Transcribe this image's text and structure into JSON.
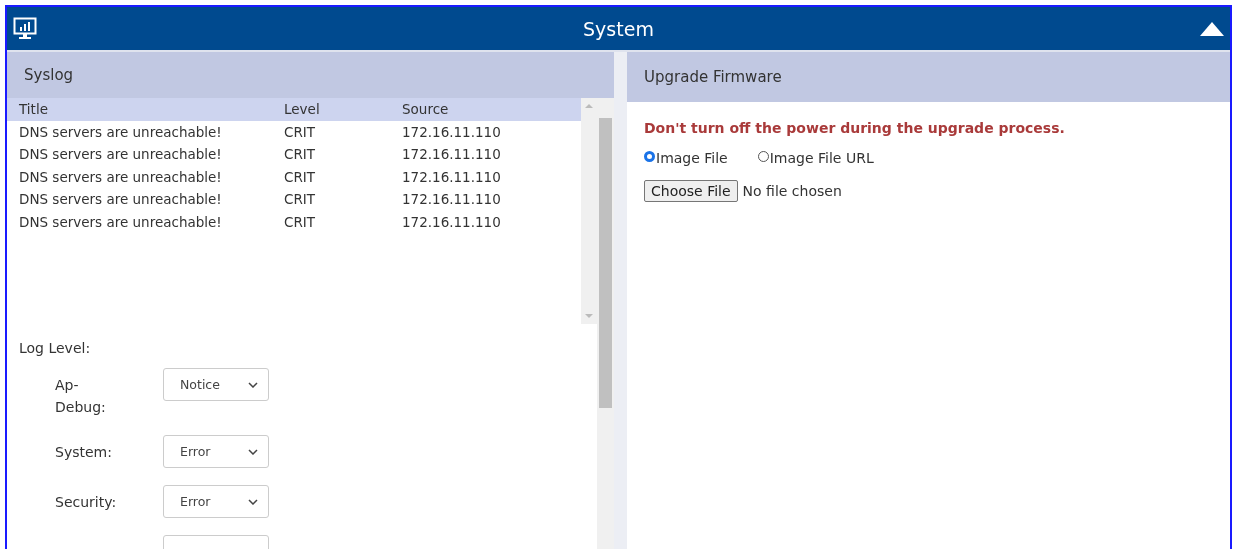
{
  "header": {
    "title": "System"
  },
  "syslog": {
    "title": "Syslog",
    "columns": [
      "Title",
      "Level",
      "Source"
    ],
    "rows": [
      [
        "DNS servers are unreachable!",
        "CRIT",
        "172.16.11.110"
      ],
      [
        "DNS servers are unreachable!",
        "CRIT",
        "172.16.11.110"
      ],
      [
        "DNS servers are unreachable!",
        "CRIT",
        "172.16.11.110"
      ],
      [
        "DNS servers are unreachable!",
        "CRIT",
        "172.16.11.110"
      ],
      [
        "DNS servers are unreachable!",
        "CRIT",
        "172.16.11.110"
      ]
    ],
    "log_level_label": "Log Level:",
    "log_levels": [
      {
        "label": "Ap-Debug:",
        "value": "Notice"
      },
      {
        "label": "System:",
        "value": "Error"
      },
      {
        "label": "Security:",
        "value": "Error"
      }
    ]
  },
  "firmware": {
    "title": "Upgrade Firmware",
    "warning": "Don't turn off the power during the upgrade process.",
    "sources": [
      {
        "label": "Image File",
        "selected": true
      },
      {
        "label": "Image File URL",
        "selected": false
      }
    ],
    "choose_button": "Choose File",
    "file_status": "No file chosen"
  }
}
